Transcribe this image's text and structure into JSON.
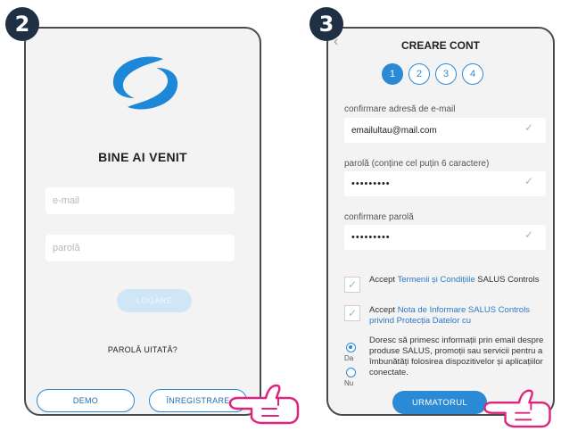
{
  "badges": {
    "login_step": "2",
    "register_step": "3"
  },
  "login": {
    "welcome_title": "BINE AI VENIT",
    "email_placeholder": "e-mail",
    "password_placeholder": "parolă",
    "login_button": "LOGARE",
    "forgot_password": "PAROLĂ UITATĂ?",
    "demo_button": "DEMO",
    "register_button": "ÎNREGISTRARE",
    "logo_icon": "salus-swirl-logo"
  },
  "register": {
    "title": "CREARE CONT",
    "back_icon": "chevron-left-icon",
    "steps": [
      "1",
      "2",
      "3",
      "4"
    ],
    "active_step": "1",
    "confirm_email_label": "confirmare adresă de e-mail",
    "confirm_email_value": "emailultau@mail.com",
    "password_label": "parolă (conține cel puțin 6 caractere)",
    "password_value": "•••••••••",
    "confirm_password_label": "confirmare parolă",
    "confirm_password_value": "•••••••••",
    "terms": {
      "prefix": "Accept",
      "link": "Termenii și Condițiile",
      "suffix": "SALUS Controls"
    },
    "privacy": {
      "prefix": "Accept",
      "link": "Nota de Informare SALUS Controls privind Protecția Datelor cu"
    },
    "marketing_text": "Doresc să primesc informații prin email despre produse SALUS, promoții sau servicii pentru a îmbunătăți folosirea dispozitivelor și aplicațiilor conectate.",
    "radio_yes": "Da",
    "radio_no": "Nu",
    "radio_selected": "Da",
    "next_button": "URMATORUL"
  },
  "colors": {
    "accent": "#2a8ad6",
    "badge": "#1f2f44",
    "pointer": "#e0237b",
    "check": "#8ad18a"
  }
}
